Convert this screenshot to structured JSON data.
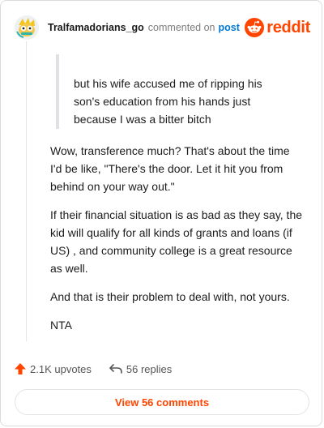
{
  "header": {
    "author": "Tralfamadorians_go",
    "meta": "commented on",
    "post_link": "post",
    "brand": "reddit"
  },
  "quote": {
    "lines": [
      "but his wife accused me of ripping his",
      "son's education from his hands just",
      "because I was a bitter bitch"
    ]
  },
  "comment": {
    "paragraphs": [
      "Wow, transference much? That's about the time I'd be like, \"There's the door. Let it hit you from behind on your way out.\"",
      "If their financial situation is as bad as they say, the kid will qualify for all kinds of grants and loans (if US) , and community college is a great resource as well.",
      "And that is their problem to deal with, not yours.",
      "NTA"
    ]
  },
  "actions": {
    "upvotes": "2.1K upvotes",
    "replies": "56 replies"
  },
  "view_comments": "View 56 comments",
  "icons": {
    "upvote": "upvote-arrow-icon",
    "reply": "reply-arrow-icon",
    "brand": "reddit-snoo-icon",
    "avatar": "user-avatar"
  },
  "colors": {
    "brand": "#ff4500",
    "link": "#0079d3"
  }
}
